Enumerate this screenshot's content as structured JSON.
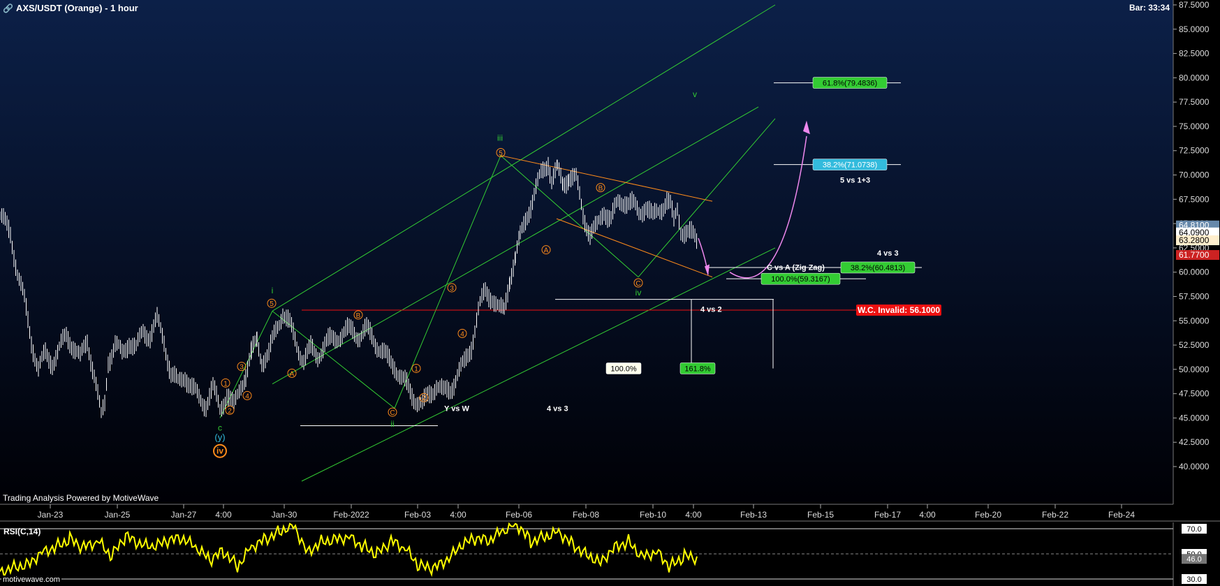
{
  "header": {
    "title": "AXS/USDT (Orange) - 1 hour",
    "bar_timer": "Bar: 33:34",
    "powered_by": "Trading Analysis Powered by MotiveWave",
    "watermark": "motivewave.com"
  },
  "colors": {
    "background_top": "#0c2048",
    "background_bottom": "#000005",
    "green": "#33cc33",
    "orange": "#ff8c1a",
    "red": "#ee1111",
    "pink": "#ee88ee",
    "rsi": "#ffff00",
    "cyan_label": "#33bbdd",
    "price_bars": "#ffffff"
  },
  "chart_data": [
    {
      "type": "line",
      "title": "AXS/USDT (Orange) - 1 hour",
      "ylim": [
        38.5,
        87.5
      ],
      "xlim": [
        0,
        1680
      ],
      "y_ticks": [
        "40.0000",
        "42.5000",
        "45.0000",
        "47.5000",
        "50.0000",
        "52.5000",
        "55.0000",
        "57.5000",
        "60.0000",
        "62.5000",
        "65.0000",
        "67.5000",
        "70.0000",
        "72.5000",
        "75.0000",
        "77.5000",
        "80.0000",
        "82.5000",
        "85.0000",
        "87.5000"
      ],
      "x_ticks": [
        {
          "label": "Jan-23",
          "x": 72
        },
        {
          "label": "Jan-25",
          "x": 168
        },
        {
          "label": "Jan-27",
          "x": 263
        },
        {
          "label": "4:00",
          "x": 320
        },
        {
          "label": "Jan-30",
          "x": 407
        },
        {
          "label": "Feb-2022",
          "x": 503
        },
        {
          "label": "Feb-03",
          "x": 598
        },
        {
          "label": "4:00",
          "x": 656
        },
        {
          "label": "Feb-06",
          "x": 743
        },
        {
          "label": "Feb-08",
          "x": 839
        },
        {
          "label": "Feb-10",
          "x": 935
        },
        {
          "label": "4:00",
          "x": 993
        },
        {
          "label": "Feb-13",
          "x": 1079
        },
        {
          "label": "Feb-15",
          "x": 1175
        },
        {
          "label": "Feb-17",
          "x": 1271
        },
        {
          "label": "4:00",
          "x": 1328
        },
        {
          "label": "Feb-20",
          "x": 1415
        },
        {
          "label": "Feb-22",
          "x": 1511
        },
        {
          "label": "Feb-24",
          "x": 1606
        }
      ],
      "series": [
        {
          "values_x": [
            0,
            15,
            25,
            35,
            45,
            55,
            65,
            75,
            85,
            95,
            105,
            115,
            125,
            135,
            145,
            150,
            155,
            165,
            175,
            185,
            195,
            205,
            215,
            225,
            235,
            245,
            255,
            265,
            275,
            285,
            295,
            305,
            315,
            325,
            335,
            345,
            352,
            360,
            368,
            375,
            385,
            395,
            405,
            415,
            425,
            435,
            445,
            455,
            465,
            475,
            485,
            495,
            505,
            515,
            525,
            535,
            545,
            555,
            565,
            575,
            585,
            595,
            605,
            615,
            625,
            635,
            645,
            655,
            665,
            675,
            685,
            695,
            705,
            715,
            722,
            730,
            738,
            745,
            755,
            765,
            775,
            785,
            790,
            798,
            806,
            815,
            825,
            835,
            845,
            855,
            865,
            875,
            885,
            895,
            905,
            915,
            925,
            935,
            945,
            955,
            960,
            965,
            970,
            975,
            985,
            995,
            1000
          ],
          "values_y": [
            65.8,
            64.0,
            60.0,
            57.0,
            53.0,
            50.0,
            51.5,
            50.8,
            52.0,
            53.5,
            52.5,
            51.0,
            53.0,
            49.5,
            45.0,
            46.5,
            51.0,
            52.5,
            51.5,
            53.0,
            52.0,
            54.0,
            53.5,
            55.0,
            53.0,
            49.5,
            48.5,
            49.5,
            48.0,
            47.0,
            46.5,
            48.0,
            46.0,
            47.5,
            46.0,
            48.5,
            49.5,
            51.5,
            53.0,
            51.0,
            51.5,
            54.0,
            56.0,
            54.5,
            52.5,
            51.0,
            52.0,
            51.5,
            52.5,
            53.0,
            53.5,
            53.8,
            54.0,
            53.5,
            54.0,
            53.2,
            52.0,
            51.0,
            50.5,
            49.0,
            48.0,
            47.0,
            46.2,
            47.5,
            48.5,
            47.5,
            48.0,
            49.5,
            50.5,
            52.5,
            56.0,
            58.0,
            57.5,
            56.0,
            56.0,
            59.5,
            61.5,
            63.5,
            66.0,
            68.0,
            70.0,
            71.5,
            69.5,
            70.5,
            69.0,
            70.0,
            69.5,
            66.0,
            64.0,
            64.5,
            66.5,
            65.5,
            67.0,
            67.5,
            67.0,
            66.0,
            67.0,
            65.5,
            66.5,
            67.5,
            66.8,
            65.0,
            66.5,
            64.5,
            64.0,
            63.5,
            63.0
          ]
        },
        {
          "name": "RSI(C,14)",
          "values_x": [
            0,
            20,
            40,
            60,
            80,
            100,
            120,
            140,
            160,
            180,
            200,
            220,
            240,
            260,
            280,
            300,
            320,
            340,
            360,
            380,
            400,
            420,
            440,
            460,
            480,
            500,
            520,
            540,
            560,
            580,
            600,
            620,
            640,
            660,
            680,
            700,
            720,
            740,
            760,
            780,
            800,
            820,
            840,
            860,
            880,
            900,
            920,
            940,
            960,
            980,
            1000
          ],
          "values_y": [
            36,
            40,
            42,
            52,
            56,
            62,
            55,
            60,
            48,
            64,
            57,
            55,
            60,
            62,
            55,
            45,
            52,
            40,
            56,
            62,
            68,
            74,
            52,
            60,
            62,
            64,
            56,
            50,
            60,
            54,
            40,
            38,
            44,
            56,
            62,
            60,
            68,
            74,
            60,
            64,
            68,
            58,
            50,
            44,
            56,
            60,
            48,
            52,
            40,
            48,
            46
          ]
        }
      ],
      "annotations": {
        "wave_labels_orange": [
          {
            "text": "1",
            "x": 323,
            "y": 48.6
          },
          {
            "text": "2",
            "x": 329,
            "y": 45.8
          },
          {
            "text": "3",
            "x": 346,
            "y": 50.3
          },
          {
            "text": "4",
            "x": 354,
            "y": 47.3
          },
          {
            "text": "5",
            "x": 389,
            "y": 56.8
          },
          {
            "text": "A",
            "x": 418,
            "y": 49.6
          },
          {
            "text": "B",
            "x": 513,
            "y": 55.6
          },
          {
            "text": "C",
            "x": 562,
            "y": 45.6
          },
          {
            "text": "1",
            "x": 596,
            "y": 50.1
          },
          {
            "text": "2",
            "x": 607,
            "y": 47.1
          },
          {
            "text": "3",
            "x": 647,
            "y": 58.4
          },
          {
            "text": "4",
            "x": 662,
            "y": 53.7
          },
          {
            "text": "5",
            "x": 717,
            "y": 72.3
          },
          {
            "text": "A",
            "x": 782,
            "y": 62.3
          },
          {
            "text": "B",
            "x": 860,
            "y": 68.7
          },
          {
            "text": "C",
            "x": 914,
            "y": 58.9
          }
        ],
        "wave_labels_green": [
          {
            "text": "c",
            "x": 315,
            "y": 44.0
          },
          {
            "text": "i",
            "x": 390,
            "y": 58.1
          },
          {
            "text": "ii",
            "x": 562,
            "y": 44.4
          },
          {
            "text": "iii",
            "x": 716,
            "y": 73.8
          },
          {
            "text": "iv",
            "x": 914,
            "y": 57.9
          },
          {
            "text": "v",
            "x": 995,
            "y": 78.3
          }
        ],
        "wave_labels_cyan": [
          {
            "text": "(y)",
            "x": 315,
            "y": 43.0
          }
        ],
        "wave_labels_circle": [
          {
            "text": "iv",
            "x": 315,
            "y": 41.6
          }
        ],
        "fib_boxes": [
          {
            "text": "61.8%(79.4836)",
            "y": 79.4836,
            "x": 1164,
            "color": "#33cc33"
          },
          {
            "text": "38.2%(71.0738)",
            "y": 71.0738,
            "x": 1164,
            "color": "#33bbdd"
          },
          {
            "text": "38.2%(60.4813)",
            "y": 60.4813,
            "x": 1204,
            "color": "#33cc33"
          },
          {
            "text": "100.0%(59.3167)",
            "y": 59.3167,
            "x": 1090,
            "color": "#33cc33"
          },
          {
            "text": "100.0%",
            "y": 50.1,
            "x": 868,
            "color": "#ffffff"
          },
          {
            "text": "161.8%",
            "y": 50.1,
            "x": 974,
            "color": "#33cc33"
          }
        ],
        "text_labels": [
          {
            "text": "5 vs 1+3",
            "x": 1203,
            "y": 69.5
          },
          {
            "text": "4 vs 3",
            "x": 1256,
            "y": 62.0
          },
          {
            "text": "C vs A (Zig Zag)",
            "x": 1098,
            "y": 60.5
          },
          {
            "text": "4 vs 2",
            "x": 1003,
            "y": 56.2
          },
          {
            "text": "Y vs W",
            "x": 636,
            "y": 46.0
          },
          {
            "text": "4 vs 3",
            "x": 783,
            "y": 46.0
          }
        ],
        "invalidation": {
          "text": "W.C. Invalid: 56.1000",
          "value": 56.1
        },
        "price_axis_boxes": [
          {
            "text": "64.8100",
            "value": 64.81,
            "color": "#6688aa"
          },
          {
            "text": "64.0900",
            "value": 64.09,
            "color": "#ffffff"
          },
          {
            "text": "63.2800",
            "value": 63.28,
            "color": "#ffeecc"
          },
          {
            "text": "61.7700",
            "value": 61.77,
            "color": "#cc2222"
          }
        ]
      }
    },
    {
      "type": "line",
      "title": "RSI(C,14)",
      "ylim": [
        25,
        75
      ],
      "y_ticks": [
        "70.0",
        "50.0",
        "30.0"
      ],
      "value_box": "46.0"
    }
  ]
}
